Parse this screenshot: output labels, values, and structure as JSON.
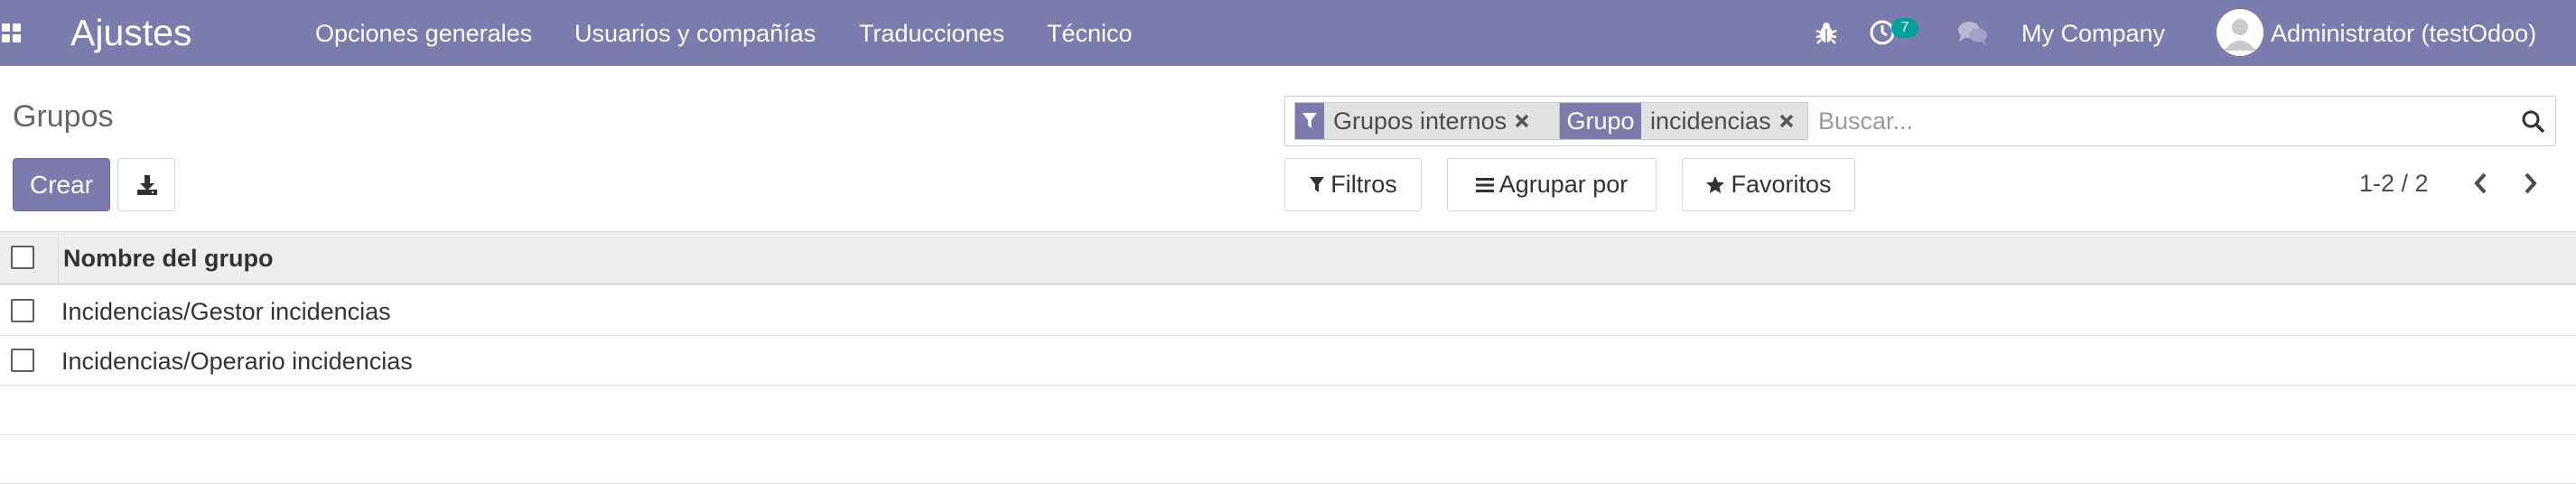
{
  "navbar": {
    "app_title": "Ajustes",
    "menu": [
      "Opciones generales",
      "Usuarios y compañías",
      "Traducciones",
      "Técnico"
    ],
    "activity_badge": "7",
    "company": "My Company",
    "user": "Administrator (testOdoo)",
    "icons": {
      "apps": "apps-grid-icon",
      "debug": "bug-icon",
      "activity": "clock-icon",
      "messages": "chat-bubbles-icon"
    }
  },
  "control_panel": {
    "title": "Grupos",
    "create_label": "Crear",
    "search": {
      "facets": [
        {
          "label_icon": "filter-icon",
          "label": "",
          "value": "Grupos internos"
        },
        {
          "label_icon": "",
          "label": "Grupo",
          "value": "incidencias"
        }
      ],
      "placeholder": "Buscar..."
    },
    "filters_label": "Filtros",
    "group_by_label": "Agrupar por",
    "favorites_label": "Favoritos",
    "pager": "1-2 / 2"
  },
  "list": {
    "column_header": "Nombre del grupo",
    "rows": [
      "Incidencias/Gestor incidencias",
      "Incidencias/Operario incidencias"
    ]
  },
  "colors": {
    "brand": "#7c7bad",
    "badge": "#00a09d",
    "header_bg": "#eeeeee"
  }
}
